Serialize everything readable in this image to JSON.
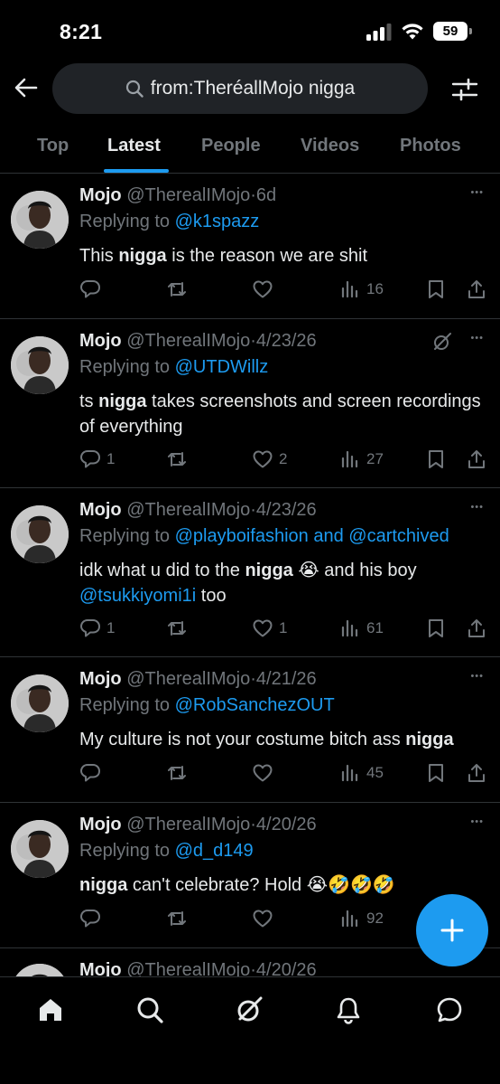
{
  "status_bar": {
    "time": "8:21",
    "battery": "59"
  },
  "search": {
    "query": "from:TheréallMojo nigga"
  },
  "tabs": [
    "Top",
    "Latest",
    "People",
    "Videos",
    "Photos"
  ],
  "active_tab": "Latest",
  "tweets": [
    {
      "name": "Mojo",
      "handle": "@TherealIMojo",
      "sep": "·",
      "date": "6d",
      "replying_prefix": "Replying to ",
      "replying_to": "@k1spazz",
      "body": [
        {
          "t": "This "
        },
        {
          "b": "nigga"
        },
        {
          "t": " is the reason we are shit"
        }
      ],
      "replies": "",
      "reposts": "",
      "likes": "",
      "views": "16"
    },
    {
      "name": "Mojo",
      "handle": "@TherealIMojo",
      "sep": "·",
      "date": "4/23/26",
      "replying_prefix": "Replying to ",
      "replying_to": "@UTDWillz",
      "body": [
        {
          "t": "ts "
        },
        {
          "b": "nigga"
        },
        {
          "t": " takes screenshots and screen recordings of everything"
        }
      ],
      "replies": "1",
      "reposts": "",
      "likes": "2",
      "views": "27"
    },
    {
      "name": "Mojo",
      "handle": "@TherealIMojo",
      "sep": "·",
      "date": "4/23/26",
      "replying_prefix": "Replying to ",
      "replying_to": "@playboifashion and @cartchived",
      "body": [
        {
          "t": "idk what u did to the "
        },
        {
          "b": "nigga"
        },
        {
          "t": " 😭 and his boy "
        },
        {
          "l": "@tsukkiyomi1i"
        },
        {
          "t": " too"
        }
      ],
      "replies": "1",
      "reposts": "",
      "likes": "1",
      "views": "61"
    },
    {
      "name": "Mojo",
      "handle": "@TherealIMojo",
      "sep": "·",
      "date": "4/21/26",
      "replying_prefix": "Replying to ",
      "replying_to": "@RobSanchezOUT",
      "body": [
        {
          "t": "My culture is not your costume bitch ass "
        },
        {
          "b": "nigga"
        }
      ],
      "replies": "",
      "reposts": "",
      "likes": "",
      "views": "45"
    },
    {
      "name": "Mojo",
      "handle": "@TherealIMojo",
      "sep": "·",
      "date": "4/20/26",
      "replying_prefix": "Replying to ",
      "replying_to": "@d_d149",
      "body": [
        {
          "b": "nigga"
        },
        {
          "t": " can't celebrate? Hold 😭🤣🤣🤣"
        }
      ],
      "replies": "",
      "reposts": "",
      "likes": "",
      "views": "92"
    },
    {
      "name": "Mojo",
      "handle": "@TherealIMojo",
      "sep": "·",
      "date": "4/20/26",
      "replying_prefix": "",
      "replying_to": "",
      "body": [],
      "replies": "",
      "reposts": "",
      "likes": "",
      "views": ""
    }
  ],
  "colors": {
    "accent": "#1d9bf0",
    "muted": "#71767b",
    "divider": "#2f3336"
  }
}
